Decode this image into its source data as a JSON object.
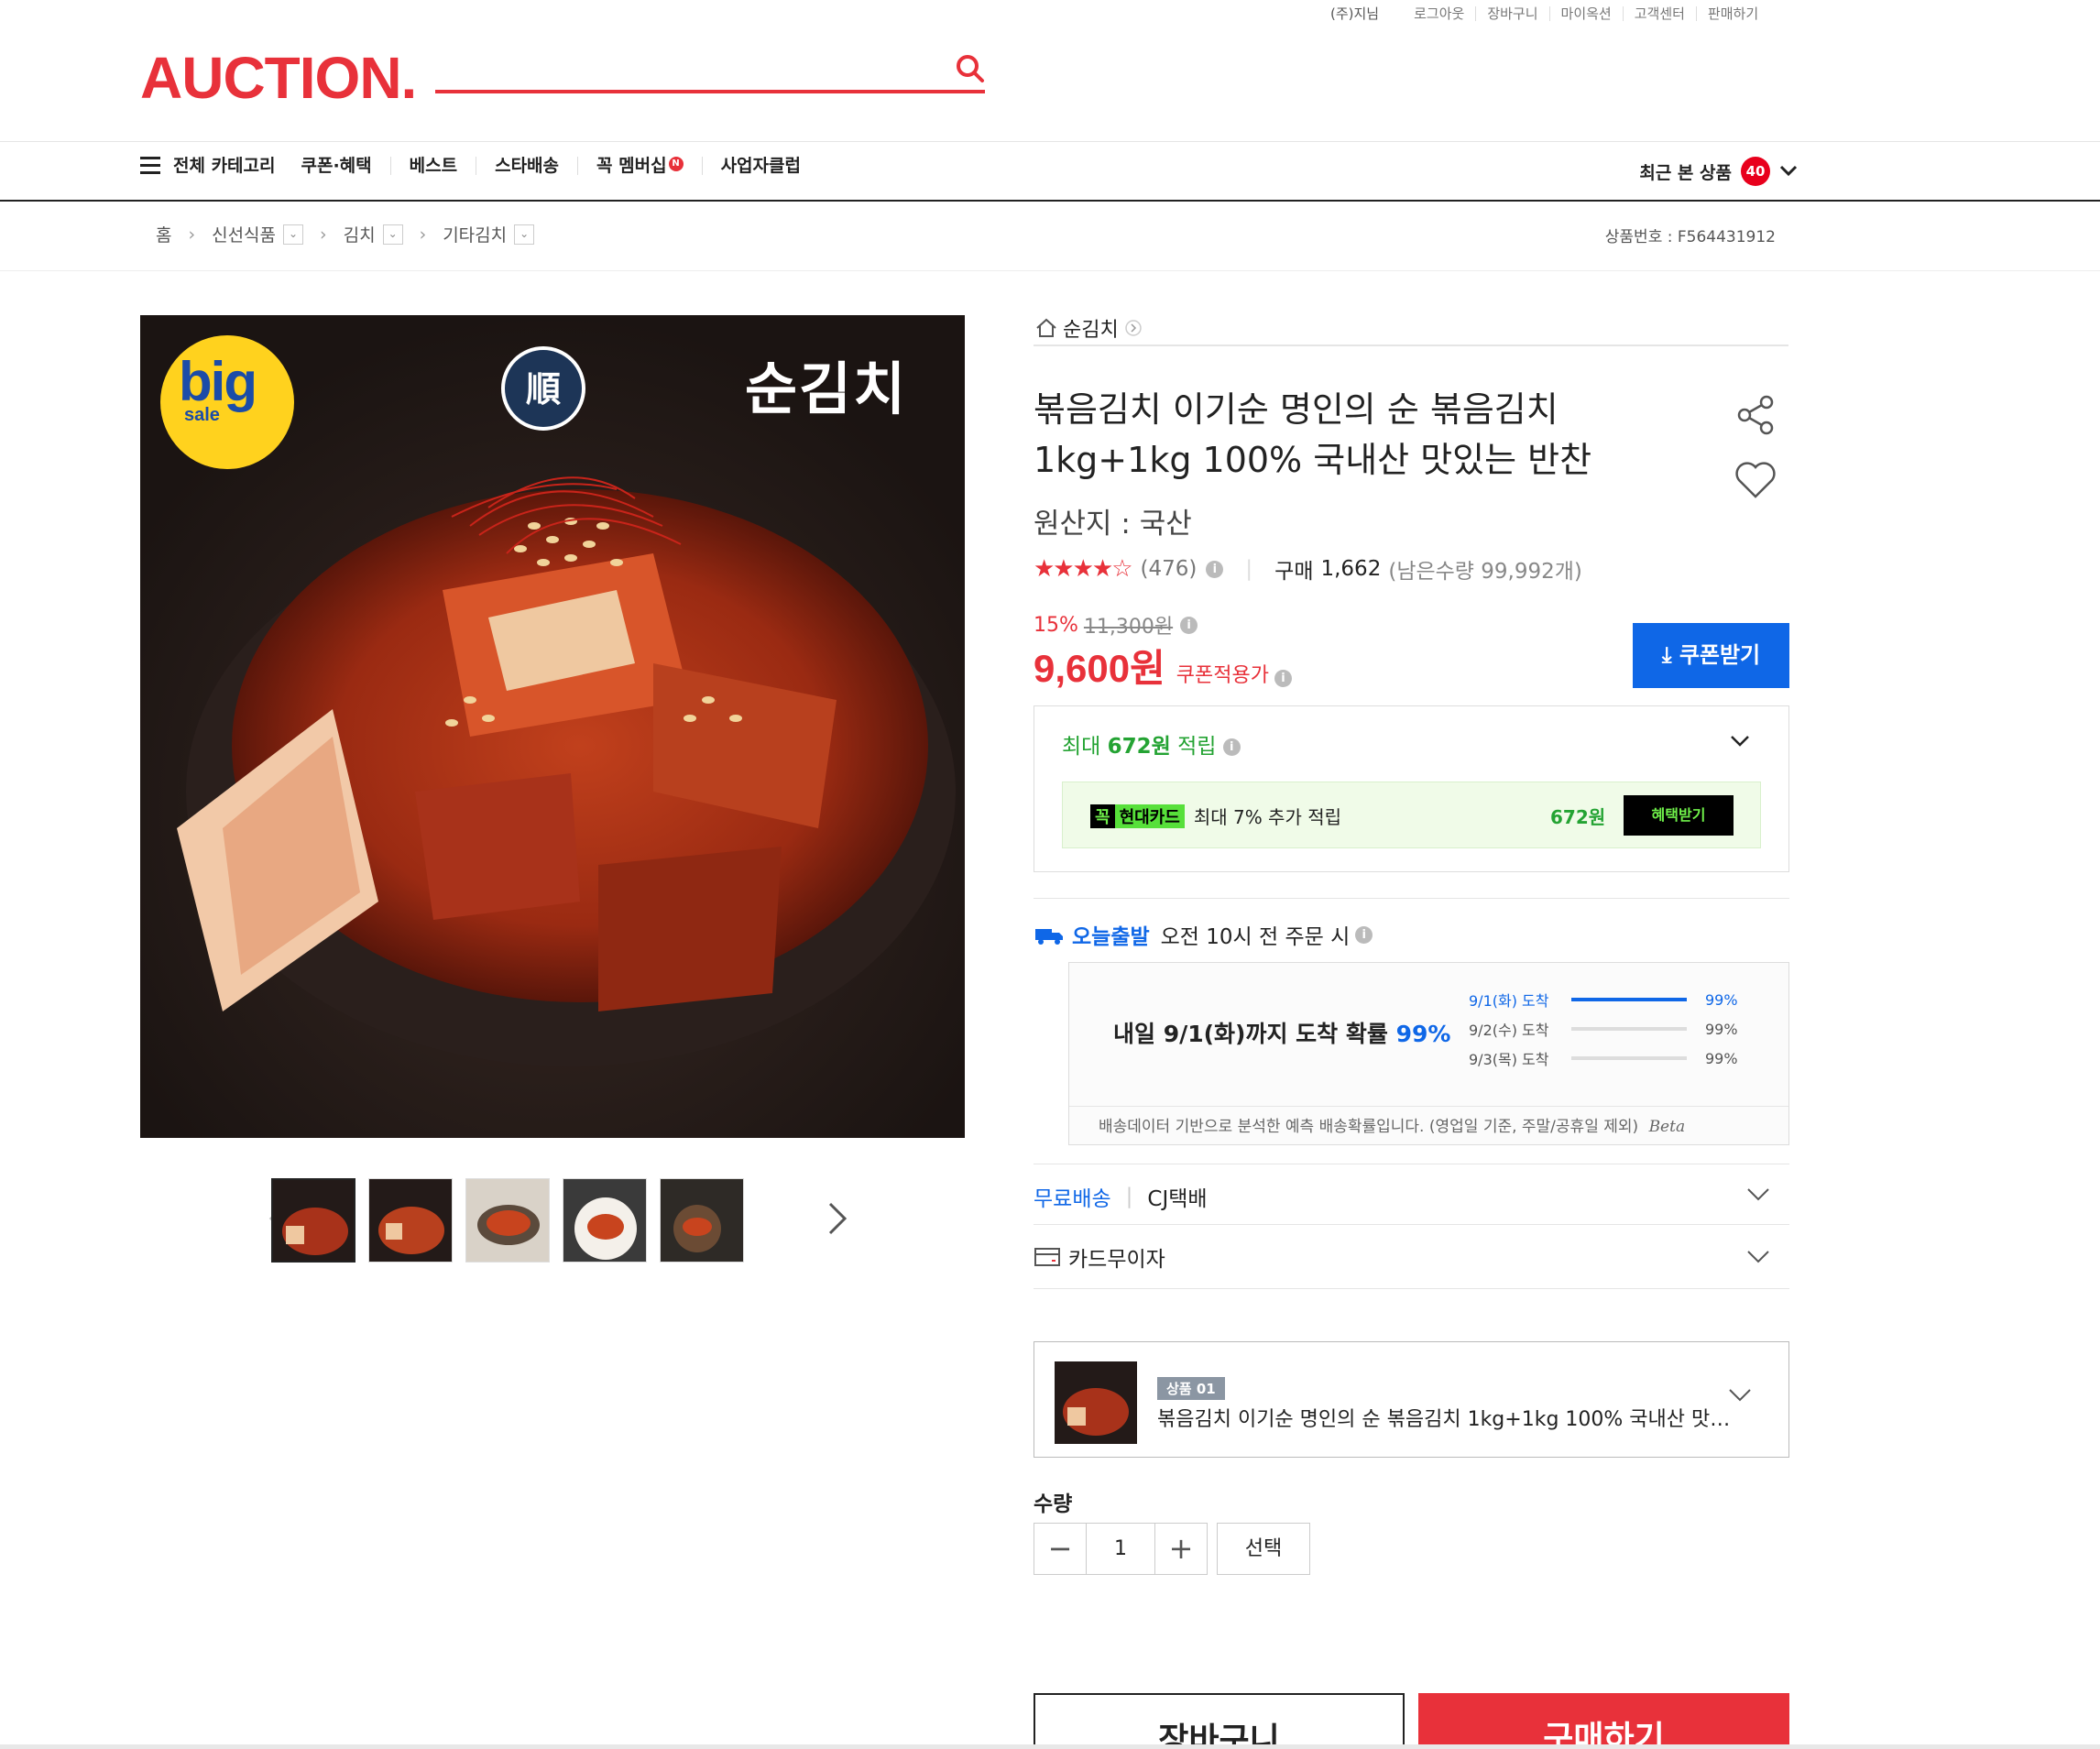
{
  "util_nav": {
    "user": "(주)지님",
    "items": [
      "로그아웃",
      "장바구니",
      "마이옥션",
      "고객센터",
      "판매하기"
    ]
  },
  "logo": "AUCTION.",
  "category_nav": {
    "all": "전체 카테고리",
    "items": [
      "쿠폰·혜택",
      "베스트",
      "스타배송",
      "꼭 멤버십",
      "사업자클럽"
    ],
    "membership_badge": "N",
    "recent": "최근 본 상품",
    "recent_count": "40"
  },
  "breadcrumb": {
    "home": "홈",
    "levels": [
      "신선식품",
      "김치",
      "기타김치"
    ],
    "product_id": "상품번호 : F564431912"
  },
  "image": {
    "badge_big": "big",
    "badge_sale": "sale",
    "brand": "순김치"
  },
  "seller": "순김치",
  "product": {
    "title": "볶음김치 이기순 명인의 순 볶음김치 1kg+1kg 100% 국내산 맛있는 반찬",
    "origin": "원산지 : 국산",
    "stars": "★★★★☆",
    "review_count": "(476)",
    "purchase_label": "구매",
    "purchase_count": "1,662",
    "remaining": "(남은수량 99,992개)",
    "discount_pct": "15%",
    "original_price": "11,300원",
    "price": "9,600원",
    "price_note": "쿠폰적용가",
    "coupon_button": "쿠폰받기"
  },
  "points": {
    "prefix": "최대",
    "amount": "672원",
    "suffix": "적립",
    "card_tag1": "꼭",
    "card_tag2": "현대카드",
    "card_text": "최대 7% 추가 적립",
    "card_amount": "672원",
    "card_button": "혜택받기"
  },
  "delivery": {
    "today_label": "오늘출발",
    "today_text": "오전 10시 전 주문 시",
    "main_text": "내일 9/1(화)까지 도착 확률",
    "main_pct": "99%",
    "rows": [
      {
        "date": "9/1(화) 도착",
        "pct": "99%",
        "fill": 1.0
      },
      {
        "date": "9/2(수) 도착",
        "pct": "99%",
        "fill": 0.0
      },
      {
        "date": "9/3(목) 도착",
        "pct": "99%",
        "fill": 0.0
      }
    ],
    "note": "배송데이터 기반으로 분석한 예측 배송확률입니다. (영업일 기준, 주말/공휴일 제외)",
    "beta": "Beta"
  },
  "shipping": {
    "free": "무료배송",
    "carrier": "CJ택배"
  },
  "card_installment": "카드무이자",
  "option": {
    "tag": "상품 01",
    "name": "볶음김치 이기순 명인의 순 볶음김치 1kg+1kg 100% 국내산 맛있는 반찬"
  },
  "quantity": {
    "label": "수량",
    "value": "1",
    "minus": "−",
    "plus": "+",
    "select": "선택"
  },
  "buttons": {
    "cart": "장바구니",
    "buy": "구매하기"
  },
  "colors": {
    "brand_red": "#e8313a",
    "accent_blue": "#0f67e7",
    "point_green": "#24a333"
  }
}
